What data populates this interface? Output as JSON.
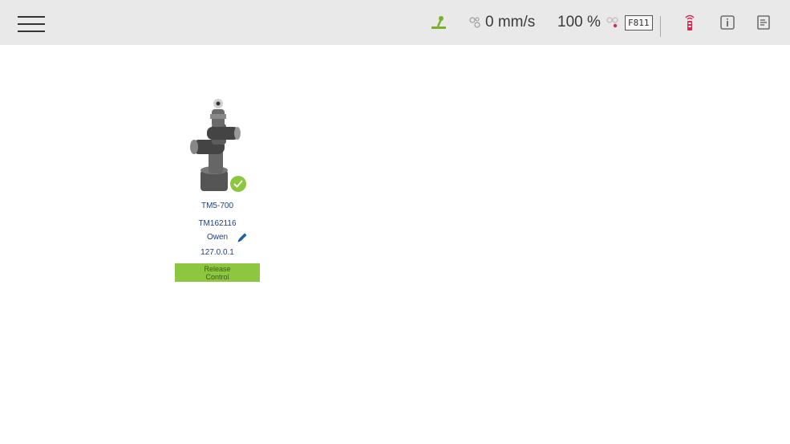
{
  "topbar": {
    "speed_value": "0 mm/s",
    "speed_percent": "100 %",
    "fcode": "F811",
    "icons": [
      "menu-icon",
      "joystick-icon",
      "speed-gear-icon",
      "connection-icon",
      "robot-status-icon",
      "info-icon",
      "log-icon"
    ]
  },
  "robot": {
    "model": "TM5-700",
    "serial": "TM162116",
    "owner": "Owen",
    "ip": "127.0.0.1",
    "release_label": "Release Control",
    "status": "connected"
  },
  "colors": {
    "accent_green": "#8dc63f",
    "topbar_bg": "#e9e9e9",
    "text_blue": "#1f3f7a",
    "alert_red": "#d62b55"
  }
}
